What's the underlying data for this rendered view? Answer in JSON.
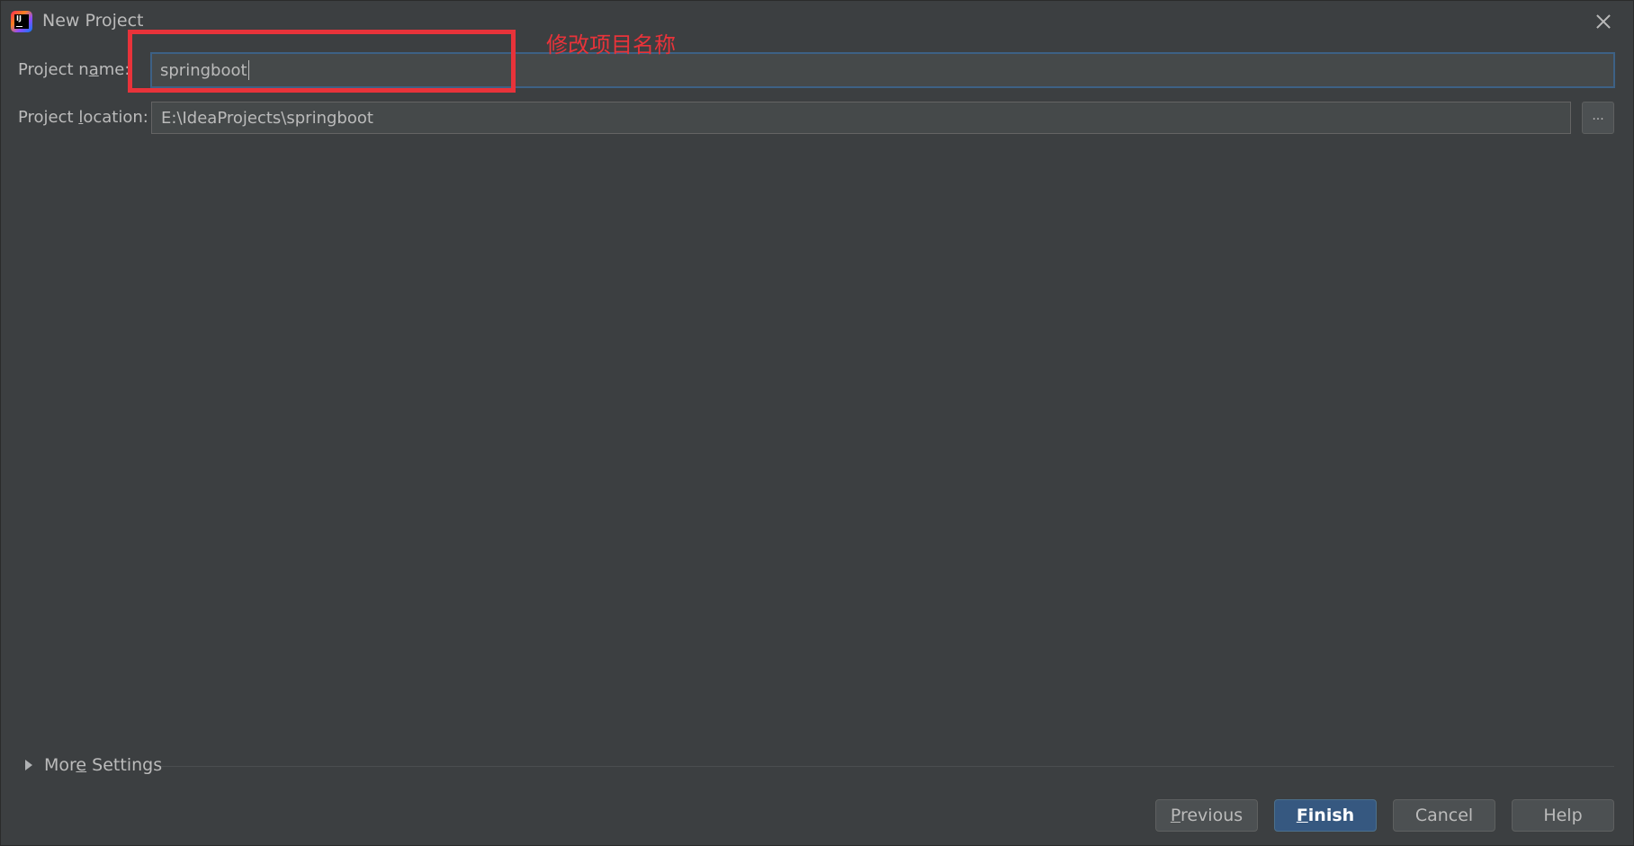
{
  "window": {
    "title": "New Project",
    "icon": "intellij-idea-icon",
    "close_icon": "close-icon"
  },
  "form": {
    "project_name": {
      "label_pre": "Project n",
      "label_mnemonic": "a",
      "label_post": "me:",
      "value": "springboot"
    },
    "project_location": {
      "label_pre": "Project ",
      "label_mnemonic": "l",
      "label_post": "ocation:",
      "value": "E:\\IdeaProjects\\springboot",
      "browse_label": "..."
    }
  },
  "annotation": {
    "text": "修改项目名称",
    "color": "#e8333a"
  },
  "more_settings": {
    "label_pre": "Mor",
    "label_mnemonic": "e",
    "label_post": " Settings"
  },
  "buttons": {
    "previous": {
      "mnemonic": "P",
      "rest": "revious"
    },
    "finish": {
      "mnemonic": "F",
      "rest": "inish"
    },
    "cancel": "Cancel",
    "help": "Help"
  },
  "colors": {
    "background": "#3c3f41",
    "field_background": "#45494a",
    "focus_border": "#3d6185",
    "primary_button": "#365880"
  }
}
